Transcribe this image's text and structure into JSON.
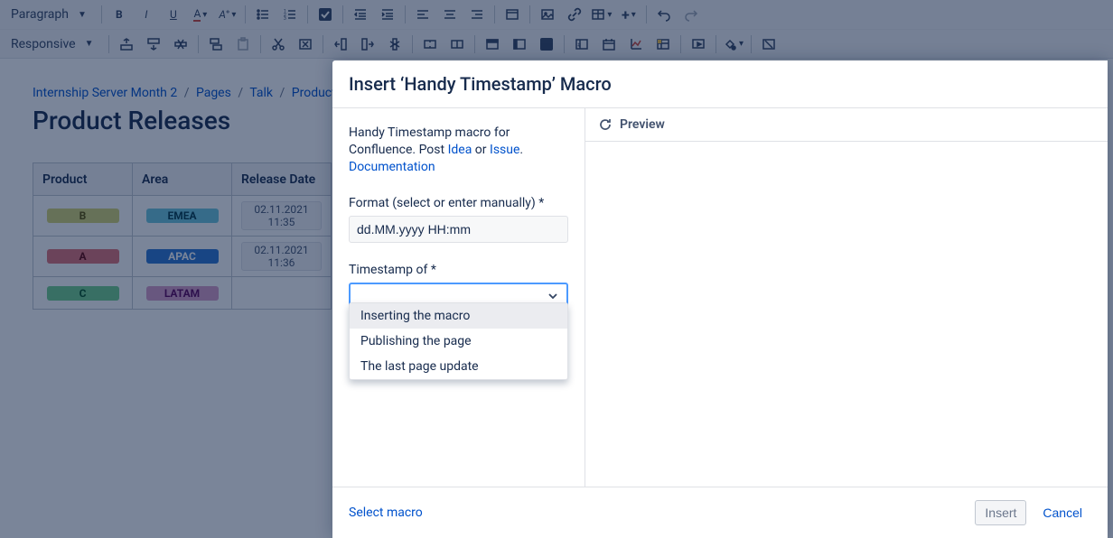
{
  "toolbar": {
    "paragraph_label": "Paragraph",
    "responsive_label": "Responsive"
  },
  "breadcrumb": {
    "parts": [
      "Internship Server Month 2",
      "Pages",
      "Talk",
      "Product R"
    ]
  },
  "page": {
    "title": "Product Releases"
  },
  "table": {
    "headers": [
      "Product",
      "Area",
      "Release Date"
    ],
    "rows": [
      {
        "product": "B",
        "product_class": "b-yellow",
        "area": "EMEA",
        "area_class": "b-cyan",
        "date": "02.11.2021 11:35"
      },
      {
        "product": "A",
        "product_class": "b-red",
        "area": "APAC",
        "area_class": "b-blue",
        "date": "02.11.2021 11:36"
      },
      {
        "product": "C",
        "product_class": "b-green",
        "area": "LATAM",
        "area_class": "b-purple",
        "date": ""
      }
    ]
  },
  "modal": {
    "title": "Insert ‘Handy Timestamp’ Macro",
    "desc_1": "Handy Timestamp macro for Confluence. Post ",
    "desc_idea": "Idea",
    "desc_or": " or ",
    "desc_issue": "Issue",
    "desc_dot": ". ",
    "desc_doc": "Documentation",
    "format_label": "Format (select or enter manually) *",
    "format_value": "dd.MM.yyyy HH:mm",
    "timestamp_label": "Timestamp of *",
    "options": [
      "Inserting the macro",
      "Publishing the page",
      "The last page update"
    ],
    "preview_label": "Preview",
    "select_macro": "Select macro",
    "insert": "Insert",
    "cancel": "Cancel"
  }
}
